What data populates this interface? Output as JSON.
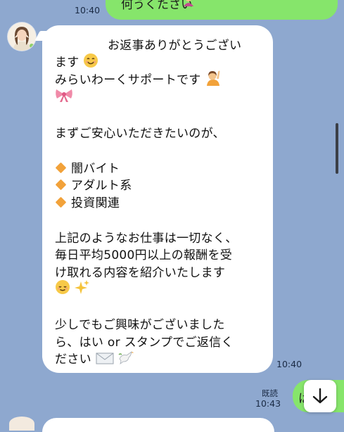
{
  "previous_message": {
    "text_partial": "何うくたさい",
    "timestamp": "10:40"
  },
  "incoming_message": {
    "lines": [
      "お返事ありがとうござい",
      "ます",
      "みらいわーくサポートです",
      "",
      "",
      "まずご安心いただきたいのが、",
      "",
      "闇バイト",
      "アダルト系",
      "投資関連",
      "",
      "上記のようなお仕事は一切なく、",
      "毎日平均5000円以上の報酬を受",
      "け取れる内容を紹介いたします",
      "",
      "",
      "少しでもご興味がございました",
      "ら、はい or スタンプでご返信く",
      "ださい"
    ],
    "timestamp": "10:40"
  },
  "outgoing_message": {
    "read_label": "既読",
    "timestamp": "10:43",
    "text_partial": "は"
  },
  "colors": {
    "chat_background": "#8ea8cf",
    "outgoing_bubble": "#86e56b",
    "incoming_bubble": "#ffffff"
  },
  "icons": [
    "smiling-face-icon",
    "raising-hand-icon",
    "ribbon-icon",
    "orange-diamond-icon",
    "relieved-face-icon",
    "sparkles-icon",
    "envelope-icon",
    "dove-icon",
    "scroll-down-arrow-icon"
  ]
}
